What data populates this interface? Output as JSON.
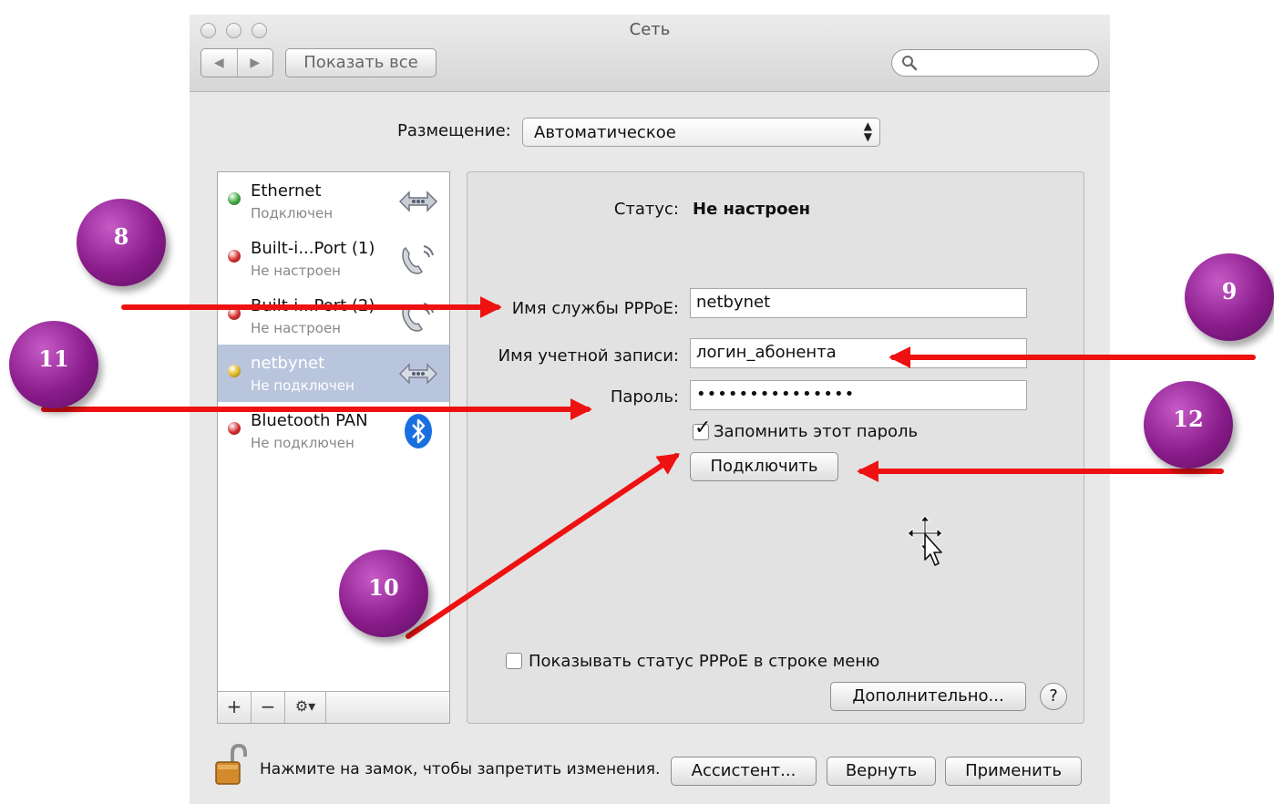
{
  "window": {
    "title": "Сеть",
    "show_all_label": "Показать все",
    "search_placeholder": ""
  },
  "location": {
    "label": "Размещение:",
    "value": "Автоматическое"
  },
  "services": [
    {
      "name": "Ethernet",
      "status": "Подключен",
      "dot_color": "#3aa83a",
      "icon": "ethernet-icon",
      "selected": false
    },
    {
      "name": "Built-i...Port (1)",
      "status": "Не настроен",
      "dot_color": "#d42a2a",
      "icon": "modem-icon",
      "selected": false
    },
    {
      "name": "Built-i...Port (2)",
      "status": "Не настроен",
      "dot_color": "#d42a2a",
      "icon": "modem-icon",
      "selected": false
    },
    {
      "name": "netbynet",
      "status": "Не подключен",
      "dot_color": "#e2b61b",
      "icon": "ethernet-icon",
      "selected": true
    },
    {
      "name": "Bluetooth PAN",
      "status": "Не подключен",
      "dot_color": "#d42a2a",
      "icon": "bluetooth-icon",
      "selected": false
    }
  ],
  "sidebar_toolbar": {
    "add": "+",
    "remove": "−",
    "gear": "⚙▾"
  },
  "details": {
    "status_label": "Статус:",
    "status_value": "Не настроен",
    "service_name_label": "Имя службы PPPoE:",
    "service_name_value": "netbynet",
    "account_label": "Имя учетной записи:",
    "account_value": "логин_абонента",
    "password_label": "Пароль:",
    "password_value": "•••••••••••••••",
    "remember_label": "Запомнить этот пароль",
    "remember_checked": true,
    "connect_label": "Подключить",
    "show_status_label": "Показывать статус PPPoE в строке меню",
    "show_status_checked": false,
    "advanced_label": "Дополнительно...",
    "help_label": "?"
  },
  "bottom": {
    "lock_text": "Нажмите на замок, чтобы запретить изменения.",
    "assistant_label": "Ассистент...",
    "revert_label": "Вернуть",
    "apply_label": "Применить"
  },
  "annotations": {
    "badges": [
      "8",
      "9",
      "10",
      "11",
      "12"
    ],
    "arrow_color": "#ee1111"
  }
}
